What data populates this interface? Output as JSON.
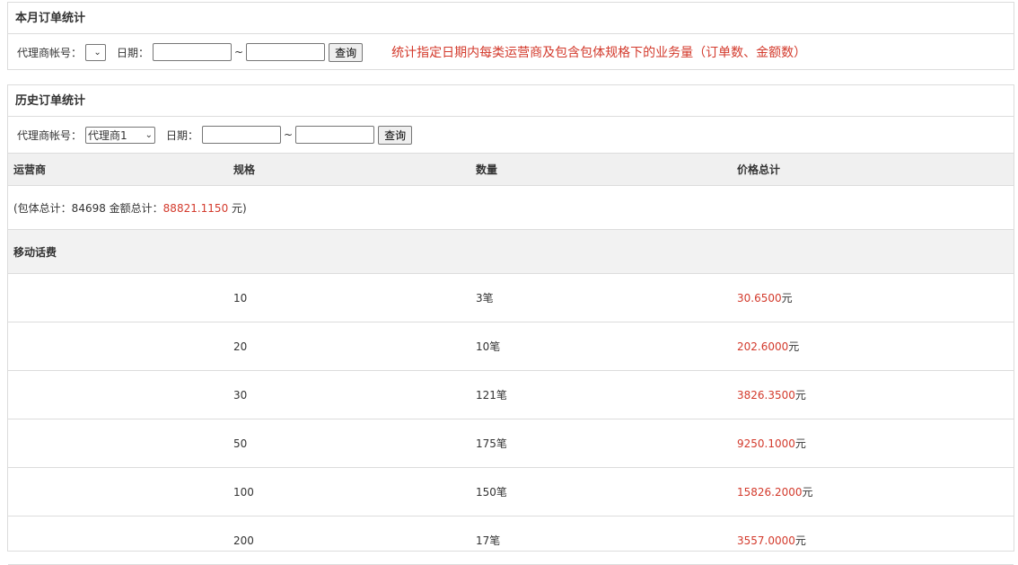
{
  "month_panel": {
    "title": "本月订单统计",
    "agent_label": "代理商帐号：",
    "agent_value": "",
    "date_label": "日期：",
    "date_from": "",
    "date_to": "",
    "tilde": "~",
    "query_button": "查询",
    "note": "统计指定日期内每类运营商及包含包体规格下的业务量（订单数、金额数）"
  },
  "history_panel": {
    "title": "历史订单统计",
    "agent_label": "代理商帐号：",
    "agent_value": "代理商1",
    "date_label": "日期：",
    "date_from": "",
    "date_to": "",
    "tilde": "~",
    "query_button": "查询",
    "table": {
      "headers": [
        "运营商",
        "规格",
        "数量",
        "价格总计"
      ],
      "summary": {
        "prefix": "(包体总计：84698 金额总计：",
        "amount": "88821.1150",
        "suffix": " 元)"
      },
      "group": "移动话费",
      "rows": [
        {
          "spec": "10",
          "qty": "3笔",
          "price": "30.6500",
          "unit": "元"
        },
        {
          "spec": "20",
          "qty": "10笔",
          "price": "202.6000",
          "unit": "元"
        },
        {
          "spec": "30",
          "qty": "121笔",
          "price": "3826.3500",
          "unit": "元"
        },
        {
          "spec": "50",
          "qty": "175笔",
          "price": "9250.1000",
          "unit": "元"
        },
        {
          "spec": "100",
          "qty": "150笔",
          "price": "15826.2000",
          "unit": "元"
        },
        {
          "spec": "200",
          "qty": "17笔",
          "price": "3557.0000",
          "unit": "元"
        }
      ]
    }
  },
  "colors": {
    "accent_red": "#d33a2c",
    "header_bg": "#f0f0f0",
    "border": "#dcdcdc"
  },
  "icons": {
    "select_chevron": "chevron-down-icon"
  }
}
